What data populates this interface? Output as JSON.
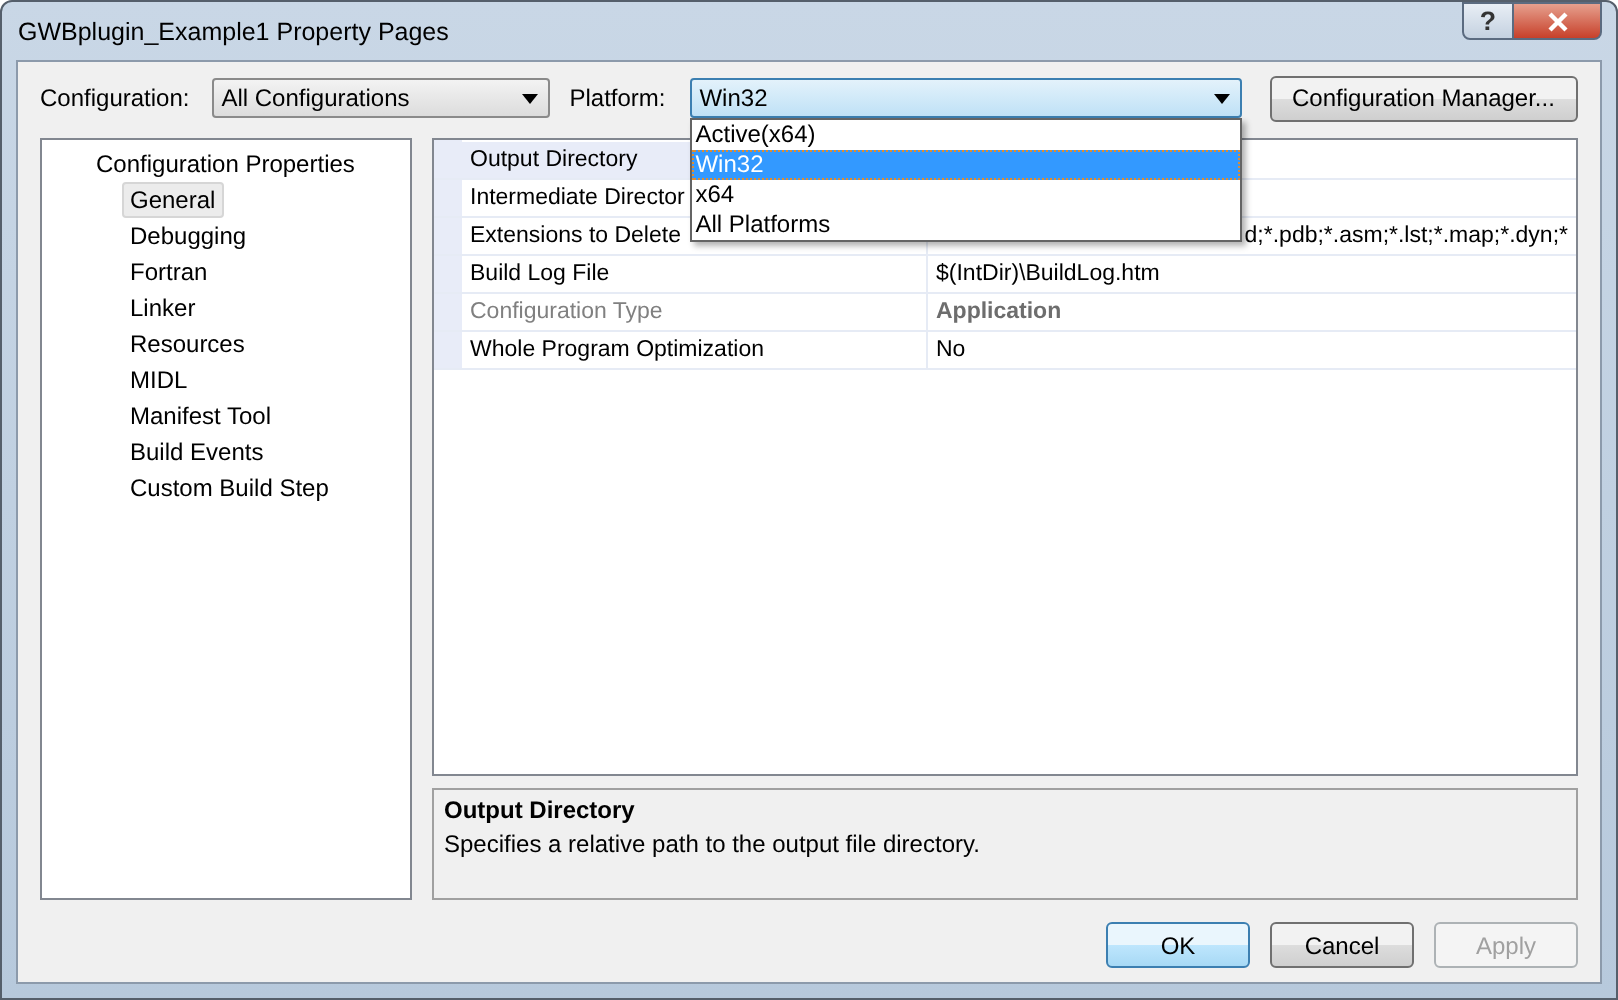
{
  "window": {
    "title": "GWBplugin_Example1 Property Pages",
    "help": "?"
  },
  "configuration": {
    "label": "Configuration:",
    "value": "All Configurations"
  },
  "platform": {
    "label": "Platform:",
    "value": "Win32",
    "expanded": true,
    "options": [
      {
        "label": "Active(x64)",
        "selected": false
      },
      {
        "label": "Win32",
        "selected": true
      },
      {
        "label": "x64",
        "selected": false
      },
      {
        "label": "All Platforms",
        "selected": false
      }
    ]
  },
  "config_manager_button": "Configuration Manager...",
  "tree": [
    {
      "label": "Configuration Properties",
      "selected": false,
      "children": [
        {
          "label": "General",
          "selected": true
        },
        {
          "label": "Debugging",
          "selected": false
        },
        {
          "label": "Fortran",
          "selected": false
        },
        {
          "label": "Linker",
          "selected": false
        },
        {
          "label": "Resources",
          "selected": false
        },
        {
          "label": "MIDL",
          "selected": false
        },
        {
          "label": "Manifest Tool",
          "selected": false
        },
        {
          "label": "Build Events",
          "selected": false
        },
        {
          "label": "Custom Build Step",
          "selected": false
        }
      ]
    }
  ],
  "properties": [
    {
      "name": "Output Directory",
      "selected": true,
      "disabled": false
    },
    {
      "name": "Intermediate Director",
      "selected": false,
      "disabled": false
    },
    {
      "name": "Extensions to Delete",
      "value": "d;*.pdb;*.asm;*.lst;*.map;*.dyn;*",
      "selected": false,
      "disabled": false
    },
    {
      "name": "Build Log File",
      "value": "$(IntDir)\\BuildLog.htm",
      "selected": false,
      "disabled": false
    },
    {
      "name": "Configuration Type",
      "value": "Application",
      "selected": false,
      "disabled": true
    },
    {
      "name": "Whole Program Optimization",
      "value": "No",
      "selected": false,
      "disabled": false
    }
  ],
  "description": {
    "title": "Output Directory",
    "text": "Specifies a relative path to the output file directory."
  },
  "buttons": [
    {
      "label": "OK",
      "kind": "default",
      "disabled": false
    },
    {
      "label": "Cancel",
      "kind": "normal",
      "disabled": false
    },
    {
      "label": "Apply",
      "kind": "normal",
      "disabled": true
    }
  ]
}
